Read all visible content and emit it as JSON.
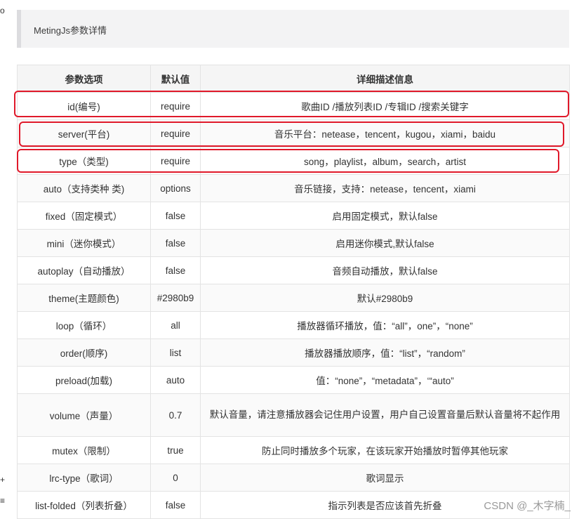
{
  "callout": {
    "text": "MetingJs参数详情"
  },
  "table": {
    "headers": [
      "参数选项",
      "默认值",
      "详细描述信息"
    ],
    "rows": [
      [
        "id(编号)",
        "require",
        "歌曲ID /播放列表ID /专辑ID /搜索关键字"
      ],
      [
        "server(平台)",
        "require",
        "音乐平台：netease，tencent，kugou，xiami，baidu"
      ],
      [
        "type（类型)",
        "require",
        "song，playlist，album，search，artist"
      ],
      [
        "auto（支持类种 类)",
        "options",
        "音乐链接，支持：netease，tencent，xiami"
      ],
      [
        "fixed（固定模式）",
        "false",
        "启用固定模式，默认false"
      ],
      [
        "mini（迷你模式）",
        "false",
        "启用迷你模式,默认false"
      ],
      [
        "autoplay（自动播放）",
        "false",
        "音频自动播放，默认false"
      ],
      [
        "theme(主题颜色)",
        "#2980b9",
        "默认#2980b9"
      ],
      [
        "loop（循环）",
        "all",
        "播放器循环播放，值：“all”，one”，“none”"
      ],
      [
        "order(顺序)",
        "list",
        "播放器播放顺序，值：“list”，“random”"
      ],
      [
        "preload(加载)",
        "auto",
        "值：“none”，“metadata”，‘“auto”"
      ],
      [
        "volume（声量）",
        "0.7",
        "默认音量，请注意播放器会记住用户设置，用户自己设置音量后默认音量将不起作用"
      ],
      [
        "mutex（限制）",
        "true",
        "防止同时播放多个玩家，在该玩家开始播放时暂停其他玩家"
      ],
      [
        "lrc-type（歌词）",
        "0",
        "歌词显示"
      ],
      [
        "list-folded（列表折叠）",
        "false",
        "指示列表是否应该首先折叠"
      ]
    ]
  },
  "watermark": "CSDN @_木字楠_",
  "side_marks": [
    "o",
    "+",
    "≡"
  ],
  "colors": {
    "highlight": "#e0192a",
    "border": "#e3e3e3",
    "header_bg": "#f5f5f5",
    "callout_bg": "#f3f3f4"
  }
}
